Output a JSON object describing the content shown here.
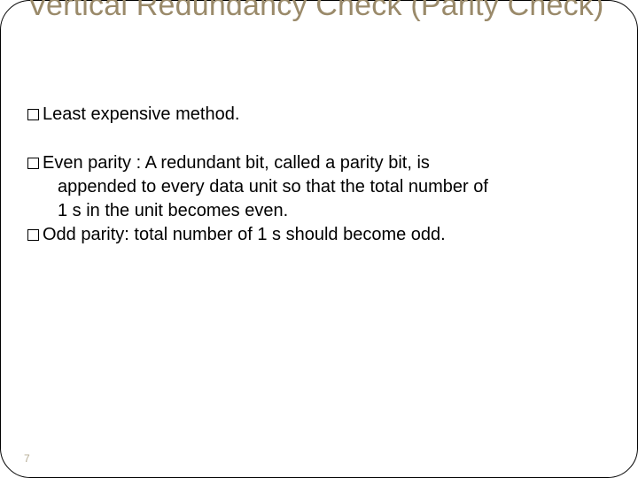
{
  "slide": {
    "title": "Vertical Redundancy Check (Parity Check)",
    "items": [
      {
        "lead": "Least",
        "rest": " expensive method."
      },
      {
        "lead": "Even",
        "rest": " parity : A redundant bit, called a parity bit, is",
        "cont": [
          "appended to every data unit so that the total number of",
          "1 s in the unit becomes even."
        ]
      },
      {
        "lead": "Odd",
        "rest": " parity: total number of 1 s should become odd."
      }
    ],
    "slide_number": "7"
  }
}
